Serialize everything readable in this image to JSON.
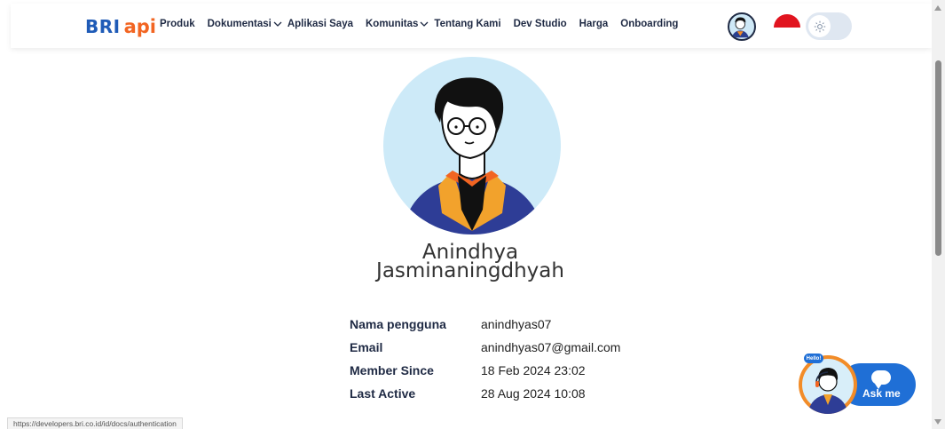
{
  "navbar": {
    "logo_bri": "BRI",
    "logo_api": "api",
    "items": [
      {
        "label": "Produk",
        "chevron": false
      },
      {
        "label": "Dokumentasi",
        "chevron": true
      },
      {
        "label": "Aplikasi Saya",
        "chevron": false
      },
      {
        "label": "Komunitas",
        "chevron": true
      },
      {
        "label": "Tentang Kami",
        "chevron": false
      },
      {
        "label": "Dev Studio",
        "chevron": false
      },
      {
        "label": "Harga",
        "chevron": false
      },
      {
        "label": "Onboarding",
        "chevron": false
      }
    ],
    "theme_toggle_icon": "sun-icon",
    "language_flag": "indonesia-flag"
  },
  "profile": {
    "name_line1": "Anindhya",
    "name_line2": "Jasminaningdhyah",
    "fields": [
      {
        "label": "Nama pengguna",
        "value": "anindhyas07"
      },
      {
        "label": "Email",
        "value": "anindhyas07@gmail.com"
      },
      {
        "label": "Member Since",
        "value": "18 Feb 2024 23:02"
      },
      {
        "label": "Last Active",
        "value": "28 Aug 2024 10:08"
      }
    ]
  },
  "status_bar": {
    "url": "https://developers.bri.co.id/id/docs/authentication"
  },
  "chat_widget": {
    "hello": "Hello!",
    "label": "Ask me",
    "icon": "chat-bubble-icon"
  },
  "colors": {
    "brand_blue": "#1f5bb7",
    "brand_orange": "#f26522",
    "nav_text": "#1f2a44",
    "chat_blue": "#1f6fd6"
  }
}
